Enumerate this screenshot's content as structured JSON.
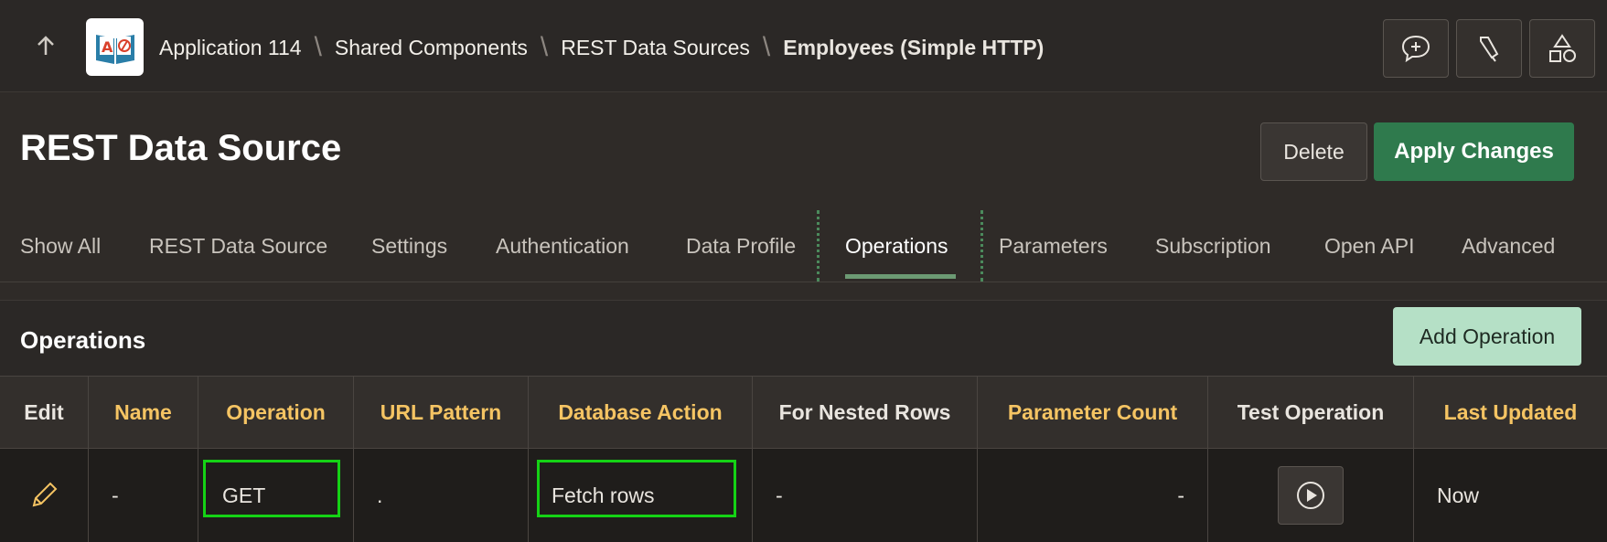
{
  "header": {
    "breadcrumb": [
      "Application 114",
      "Shared Components",
      "REST Data Sources"
    ],
    "current": "Employees (Simple HTTP)",
    "logo_text": "A",
    "icons": [
      "arrow-up-icon",
      "feedback-icon",
      "highlighter-icon",
      "shapes-icon"
    ]
  },
  "page": {
    "title": "REST Data Source",
    "delete_label": "Delete",
    "apply_label": "Apply Changes"
  },
  "tabs": [
    {
      "label": "Show All"
    },
    {
      "label": "REST Data Source"
    },
    {
      "label": "Settings"
    },
    {
      "label": "Authentication"
    },
    {
      "label": "Data Profile"
    },
    {
      "label": "Operations",
      "active": true
    },
    {
      "label": "Parameters"
    },
    {
      "label": "Subscription"
    },
    {
      "label": "Open API"
    },
    {
      "label": "Advanced"
    }
  ],
  "region": {
    "title": "Operations",
    "add_label": "Add Operation"
  },
  "table": {
    "columns": [
      "Edit",
      "Name",
      "Operation",
      "URL Pattern",
      "Database Action",
      "For Nested Rows",
      "Parameter Count",
      "Test Operation",
      "Last Updated"
    ],
    "row": {
      "name": "-",
      "operation": "GET",
      "url_pattern": ".",
      "database_action": "Fetch rows",
      "for_nested_rows": "-",
      "parameter_count": "-",
      "last_updated": "Now"
    }
  },
  "colors": {
    "accent_green": "#2f7a4d",
    "sortable_header": "#f5c463",
    "highlight": "#15d215"
  }
}
